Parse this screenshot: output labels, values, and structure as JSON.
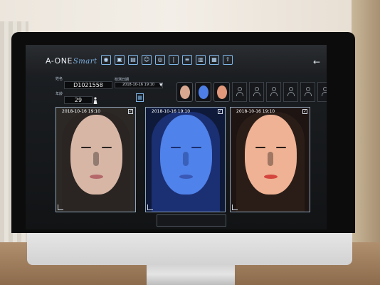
{
  "app": {
    "brand": "A-ONE",
    "brand_script": "Smart",
    "toolbar_icons": [
      "camera-icon",
      "image-icon",
      "compare-icon",
      "portrait-icon",
      "face-scan-icon",
      "chart-icon",
      "report-icon",
      "print-icon",
      "save-icon",
      "export-icon"
    ],
    "back_icon": "arrow-left-icon"
  },
  "patient": {
    "name_label": "姓名",
    "id": "D1021558",
    "age_label": "年龄",
    "age": "29",
    "gender_icon": "person-icon"
  },
  "session": {
    "date_label": "检测日期",
    "date": "2018-10-16 19:10"
  },
  "thumbs": [
    {
      "name": "natural",
      "tone": "#d9a890"
    },
    {
      "name": "uv",
      "tone": "#4e7fe6"
    },
    {
      "name": "polarized",
      "tone": "#e2987a"
    }
  ],
  "empty_slots": 6,
  "panels": [
    {
      "timestamp": "2018-10-16 19:10",
      "mode": "natural",
      "skin": "#d8b6a6",
      "hair": "#2a2522",
      "lip": "#b5686a",
      "bg": "#2b2825"
    },
    {
      "timestamp": "2018-10-16 19:10",
      "mode": "uv",
      "skin": "#4f82ea",
      "hair": "#1b2f73",
      "lip": "#3a58b6",
      "bg": "#0f1a3a"
    },
    {
      "timestamp": "2018-10-16 19:10",
      "mode": "polarized",
      "skin": "#efb294",
      "hair": "#2a1d18",
      "lip": "#d5463e",
      "bg": "#1e1412"
    }
  ]
}
